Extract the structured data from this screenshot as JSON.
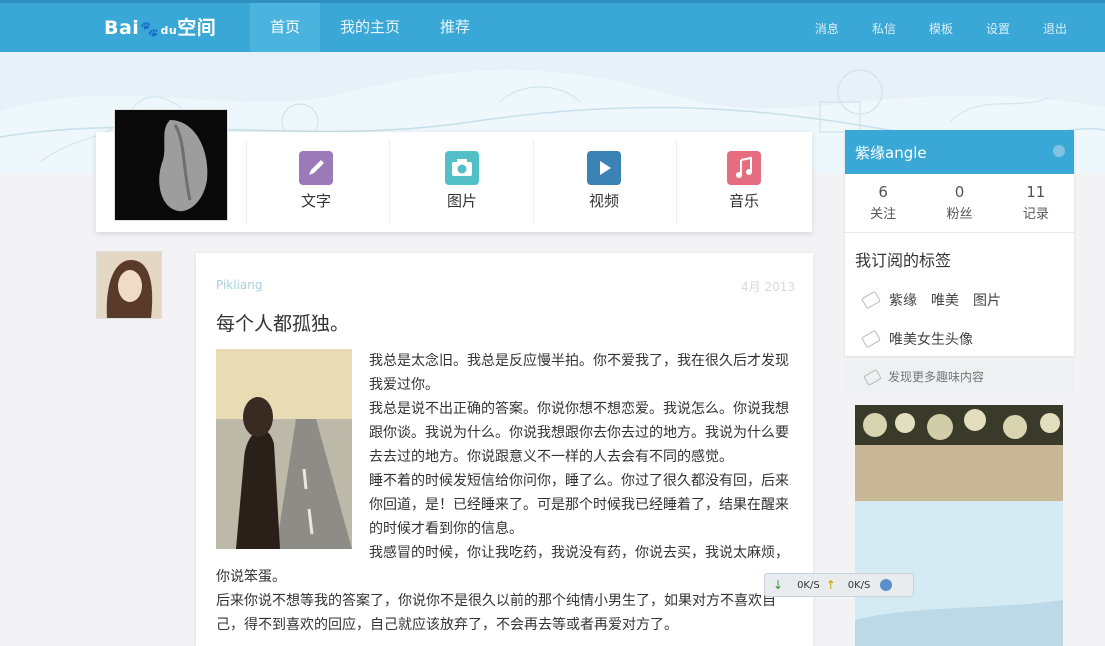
{
  "colors": {
    "accent": "#3aa8d6",
    "page_bg": "#f3f3f5"
  },
  "logo": {
    "part1": "Bai",
    "paw": "du",
    "part2": "空间"
  },
  "nav": {
    "items": [
      "首页",
      "我的主页",
      "推荐"
    ]
  },
  "topright": {
    "items": [
      "消息",
      "私信",
      "模板",
      "设置",
      "退出"
    ]
  },
  "post_types": [
    {
      "label": "文字",
      "icon": "pencil-icon",
      "color": "#9c79b8"
    },
    {
      "label": "图片",
      "icon": "camera-icon",
      "color": "#53c0c8"
    },
    {
      "label": "视频",
      "icon": "play-icon",
      "color": "#3b82b6"
    },
    {
      "label": "音乐",
      "icon": "music-note-icon",
      "color": "#e46e7f"
    }
  ],
  "sidebar": {
    "username": "紫缘angle",
    "stats": [
      {
        "num": "6",
        "label": "关注"
      },
      {
        "num": "0",
        "label": "粉丝"
      },
      {
        "num": "11",
        "label": "记录"
      }
    ],
    "tags_title": "我订阅的标签",
    "tags_row1": [
      "紫缘",
      "唯美",
      "图片"
    ],
    "tags_row2": [
      "唯美女生头像"
    ],
    "discover": "发现更多趣味内容"
  },
  "post": {
    "author": "Pikliang",
    "time": "4月 2013",
    "title": "每个人都孤独。",
    "para1": "我总是太念旧。我总是反应慢半拍。你不爱我了，我在很久后才发现我爱过你。",
    "para2": "我总是说不出正确的答案。你说你想不想恋爱。我说怎么。你说我想跟你谈。我说为什么。你说我想跟你去你去过的地方。我说为什么要去去过的地方。你说跟意义不一样的人去会有不同的感觉。",
    "para3": "睡不着的时候发短信给你问你，睡了么。你过了很久都没有回，后来你回道，是！已经睡来了。可是那个时候我已经睡着了，结果在醒来的时候才看到你的信息。",
    "para4": "我感冒的时候，你让我吃药，我说没有药，你说去买，我说太麻烦，",
    "para5": "你说笨蛋。",
    "para6": "后来你说不想等我的答案了，你说你不是很久以前的那个纯情小男生了，如果对方不喜欢自己，得不到喜欢的回应，自己就应该放弃了，不会再去等或者再爱对方了。"
  },
  "netwidget": {
    "down": "0K/S",
    "up": "0K/S"
  }
}
